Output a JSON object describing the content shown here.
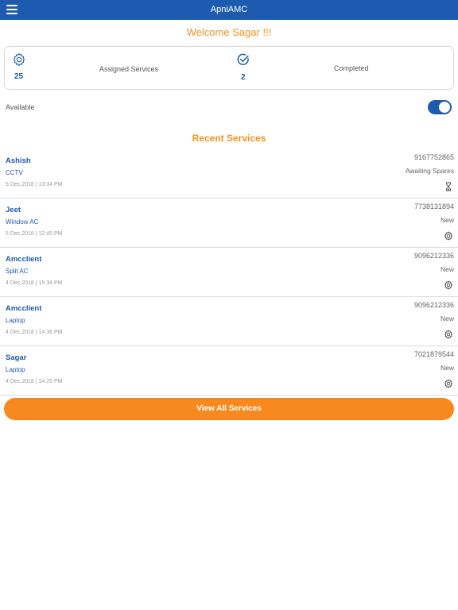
{
  "header": {
    "title": "ApniAMC",
    "menu_icon": "hamburger-menu-icon"
  },
  "welcome": "Welcome Sagar !!!",
  "stats": {
    "assigned": {
      "count": "25",
      "label": "Assigned Services",
      "icon": "gear-icon"
    },
    "completed": {
      "count": "2",
      "label": "Completed",
      "icon": "check-circle-icon"
    }
  },
  "availability": {
    "label": "Available",
    "enabled": true
  },
  "recent_title": "Recent Services",
  "services": [
    {
      "name": "Ashish",
      "type": "CCTV",
      "date": "5 Dec,2018 | 13:34 PM",
      "phone": "9167752865",
      "status": "Awaiting Spares",
      "icon": "hourglass-icon"
    },
    {
      "name": "Jeet",
      "type": "Window AC",
      "date": "5 Dec,2018 | 12:45 PM",
      "phone": "7738131894",
      "status": "New",
      "icon": "gear-icon"
    },
    {
      "name": "Amcclient",
      "type": "Split AC",
      "date": "4 Dec,2018 | 15:34 PM",
      "phone": "9096212336",
      "status": "New",
      "icon": "gear-icon"
    },
    {
      "name": "Amcclient",
      "type": "Laptop",
      "date": "4 Dec,2018 | 14:36 PM",
      "phone": "9096212336",
      "status": "New",
      "icon": "gear-icon"
    },
    {
      "name": "Sagar",
      "type": "Laptop",
      "date": "4 Dec,2018 | 14:25 PM",
      "phone": "7021879544",
      "status": "New",
      "icon": "gear-icon"
    }
  ],
  "view_all_label": "View All Services",
  "colors": {
    "primary": "#1d5bb0",
    "accent": "#f7891f",
    "welcome": "#f39421"
  }
}
